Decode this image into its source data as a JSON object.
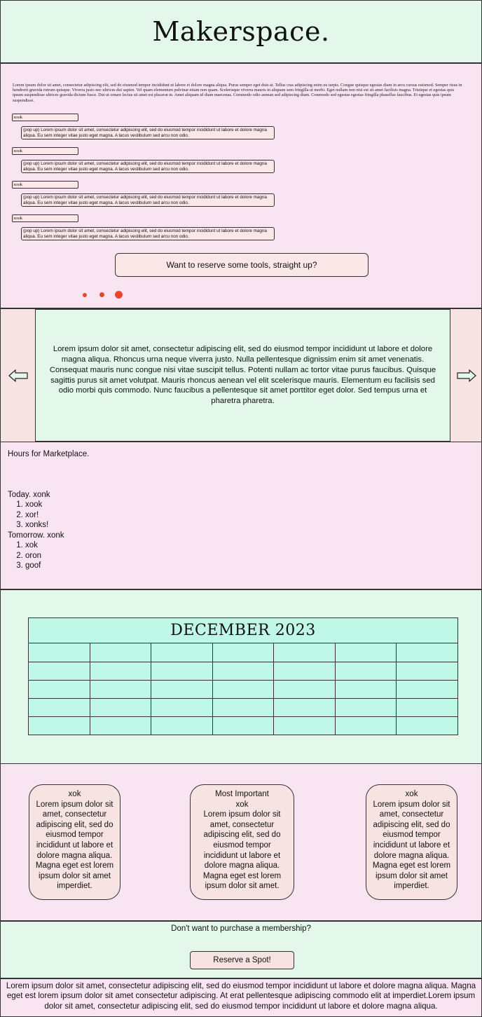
{
  "header": {
    "title": "Makerspace."
  },
  "intro": {
    "paragraph": "Lorem ipsum dolor sit amet, consectetur adipiscing elit, sed do eiusmod tempor incididunt ut labore et dolore magna aliqua. Purus semper eget duis at. Tellus cras adipiscing enim eu turpis. Congue quisque egestas diam in arcu cursus euismod. Semper risus in hendrerit gravida rutrum quisque. Viverra justo nec ultrices dui sapien. Vel quam elementum pulvinar etiam non quam. Scelerisque viverra mauris in aliquam sem fringilla ut morbi. Eget nullam non nisi est sit amet facilisis magna. Tristique et egestas quis ipsum suspendisse ultrices gravida dictum fusce. Dui ut ornare lectus sit amet est placerat in. Amet aliquam id diam maecenas. Commodo odio aenean sed adipiscing diam. Commodo sed egestas egestas fringilla phasellus faucibus. Et egestas quis ipsum suspendisse.",
    "faq": [
      {
        "q": "xook",
        "a": "(pop up) Lorem ipsum dolor sit amet, consectetur adipiscing elit, sed do eiusmod tempor incididunt ut labore et dolore magna aliqua. Eu sem integer vitae justo eget magna. A lacus vestibulum sed arcu non odio."
      },
      {
        "q": "xook",
        "a": "(pop up) Lorem ipsum dolor sit amet, consectetur adipiscing elit, sed do eiusmod tempor incididunt ut labore et dolore magna aliqua. Eu sem integer vitae justo eget magna. A lacus vestibulum sed arcu non odio."
      },
      {
        "q": "xook",
        "a": "(pop up) Lorem ipsum dolor sit amet, consectetur adipiscing elit, sed do eiusmod tempor incididunt ut labore et dolore magna aliqua. Eu sem integer vitae justo eget magna. A lacus vestibulum sed arcu non odio."
      },
      {
        "q": "xook",
        "a": "(pop up) Lorem ipsum dolor sit amet, consectetur adipiscing elit, sed do eiusmod tempor incididunt ut labore et dolore magna aliqua. Eu sem integer vitae justo eget magna. A lacus vestibulum sed arcu non odio."
      }
    ],
    "reserve_button": "Want to reserve some tools, straight up?",
    "dot_color": "#e8462f"
  },
  "carousel": {
    "text": "Lorem ipsum dolor sit amet, consectetur adipiscing elit, sed do eiusmod tempor incididunt ut labore et dolore magna aliqua. Rhoncus urna neque viverra justo. Nulla pellentesque dignissim enim sit amet venenatis. Consequat mauris nunc congue nisi vitae suscipit tellus. Potenti nullam ac tortor vitae purus faucibus. Quisque sagittis purus sit amet volutpat. Mauris rhoncus aenean vel elit scelerisque mauris. Elementum eu facilisis sed odio morbi quis commodo. Nunc faucibus a pellentesque sit amet porttitor eget dolor. Sed tempus urna et pharetra pharetra.",
    "prev_icon": "arrow-left-icon",
    "next_icon": "arrow-right-icon"
  },
  "hours": {
    "title": "Hours for Marketplace.",
    "today_label": "Today. xonk",
    "today_items": [
      "xook",
      "xor!",
      "xonks!"
    ],
    "tomorrow_label": "Tomorrow. xonk",
    "tomorrow_items": [
      "xok",
      "oron",
      "goof"
    ]
  },
  "calendar": {
    "month": "DECEMBER 2023",
    "fill": "#c0f8e8"
  },
  "plans": {
    "cards": [
      {
        "text": "xok\nLorem ipsum dolor sit amet, consectetur adipiscing elit, sed do eiusmod tempor incididunt ut labore et dolore magna aliqua. Magna eget est lorem ipsum dolor sit amet imperdiet."
      },
      {
        "text": "Most Important\nxok\nLorem ipsum dolor sit amet, consectetur adipiscing elit, sed do eiusmod tempor incididunt ut labore et dolore magna aliqua. Magna eget est lorem ipsum dolor sit amet."
      },
      {
        "text": "xok\nLorem ipsum dolor sit amet, consectetur adipiscing elit, sed do eiusmod tempor incididunt ut labore et dolore magna aliqua. Magna eget est lorem ipsum dolor sit amet imperdiet."
      }
    ]
  },
  "membership": {
    "question": "Don't want to purchase a membership?",
    "button": "Reserve a Spot!"
  },
  "footer": {
    "text": "Lorem ipsum dolor sit amet, consectetur adipiscing elit, sed do eiusmod tempor incididunt ut labore et dolore magna aliqua. Magna eget est lorem ipsum dolor sit amet consectetur adipiscing. At erat pellentesque adipiscing commodo elit at imperdiet.Lorem ipsum dolor sit amet, consectetur adipiscing elit, sed do eiusmod tempor incididunt ut labore et dolore magna aliqua."
  }
}
